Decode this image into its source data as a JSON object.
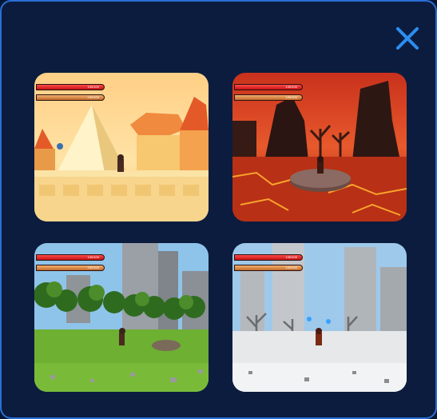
{
  "dialog": {
    "close_icon": "close-icon",
    "accent_color": "#2b6fd6",
    "background_color": "#0b1c3f"
  },
  "levels": [
    {
      "id": "desert",
      "hp_text": "100/100",
      "energy_text": "100/100"
    },
    {
      "id": "lava",
      "hp_text": "100/100",
      "energy_text": "100/100"
    },
    {
      "id": "forest",
      "hp_text": "100/100",
      "energy_text": "100/100"
    },
    {
      "id": "snow",
      "hp_text": "100/100",
      "energy_text": "100/100"
    }
  ]
}
